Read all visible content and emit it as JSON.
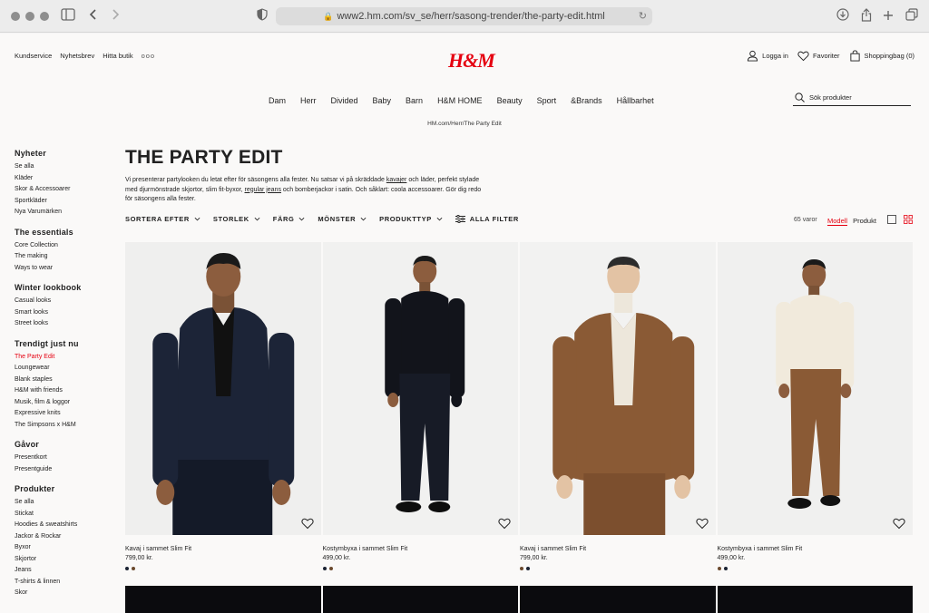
{
  "browser": {
    "url": "www2.hm.com/sv_se/herr/sasong-trender/the-party-edit.html"
  },
  "header": {
    "utility_links": [
      "Kundservice",
      "Nyhetsbrev",
      "Hitta butik"
    ],
    "more": "ooo",
    "logo": "H&M",
    "login": "Logga in",
    "favorites": "Favoriter",
    "bag": "Shoppingbag (0)"
  },
  "nav": {
    "items": [
      "Dam",
      "Herr",
      "Divided",
      "Baby",
      "Barn",
      "H&M HOME",
      "Beauty",
      "Sport",
      "&Brands",
      "Hållbarhet"
    ]
  },
  "search": {
    "placeholder": "Sök produkter"
  },
  "breadcrumb": "HM.com/Herr/The Party Edit",
  "sidebar": [
    {
      "heading": "Nyheter",
      "links": [
        "Se alla",
        "Kläder",
        "Skor & Accessoarer",
        "Sportkläder",
        "Nya Varumärken"
      ]
    },
    {
      "heading": "The essentials",
      "links": [
        "Core Collection",
        "The making",
        "Ways to wear"
      ]
    },
    {
      "heading": "Winter lookbook",
      "links": [
        "Casual looks",
        "Smart looks",
        "Street looks"
      ]
    },
    {
      "heading": "Trendigt just nu",
      "links": [
        "The Party Edit",
        "Loungewear",
        "Blank staples",
        "H&M with friends",
        "Musik, film & loggor",
        "Expressive knits",
        "The Simpsons x H&M"
      ],
      "active": "The Party Edit"
    },
    {
      "heading": "Gåvor",
      "links": [
        "Presentkort",
        "Presentguide"
      ]
    },
    {
      "heading": "Produkter",
      "links": [
        "Se alla",
        "Stickat",
        "Hoodies & sweatshirts",
        "Jackor & Rockar",
        "Byxor",
        "Skjortor",
        "Jeans",
        "T-shirts & linnen",
        "Skor"
      ]
    }
  ],
  "main": {
    "title": "THE PARTY EDIT",
    "intro_1": "Vi presenterar partylooken du letat efter för säsongens alla fester. Nu satsar vi på skräddade ",
    "intro_link_1": "kavajer",
    "intro_2": " och läder, perfekt stylade med djurmönstrade skjortor, slim fit-byxor, ",
    "intro_link_2": "regular jeans",
    "intro_3": " och bomberjackor i satin. Och såklart: coola accessoarer. Gör dig redo för säsongens alla fester.",
    "filters": [
      "SORTERA EFTER",
      "STORLEK",
      "FÄRG",
      "MÖNSTER",
      "PRODUKTTYP"
    ],
    "all_filters": "ALLA FILTER",
    "count": "65 varor",
    "view_model": "Modell",
    "view_product": "Produkt"
  },
  "products": [
    {
      "name": "Kavaj i sammet Slim Fit",
      "price": "799,00 kr.",
      "colors": [
        "#1b2333",
        "#6b4a2e"
      ]
    },
    {
      "name": "Kostymbyxa i sammet Slim Fit",
      "price": "499,00 kr.",
      "colors": [
        "#1b2333",
        "#6b4a2e"
      ]
    },
    {
      "name": "Kavaj i sammet Slim Fit",
      "price": "799,00 kr.",
      "colors": [
        "#6b4a2e",
        "#1b2333"
      ]
    },
    {
      "name": "Kostymbyxa i sammet Slim Fit",
      "price": "499,00 kr.",
      "colors": [
        "#6b4a2e",
        "#1b2333"
      ]
    }
  ],
  "colors": {
    "accent": "#e50010",
    "navy": "#1b2333",
    "tan": "#8a5a35"
  }
}
